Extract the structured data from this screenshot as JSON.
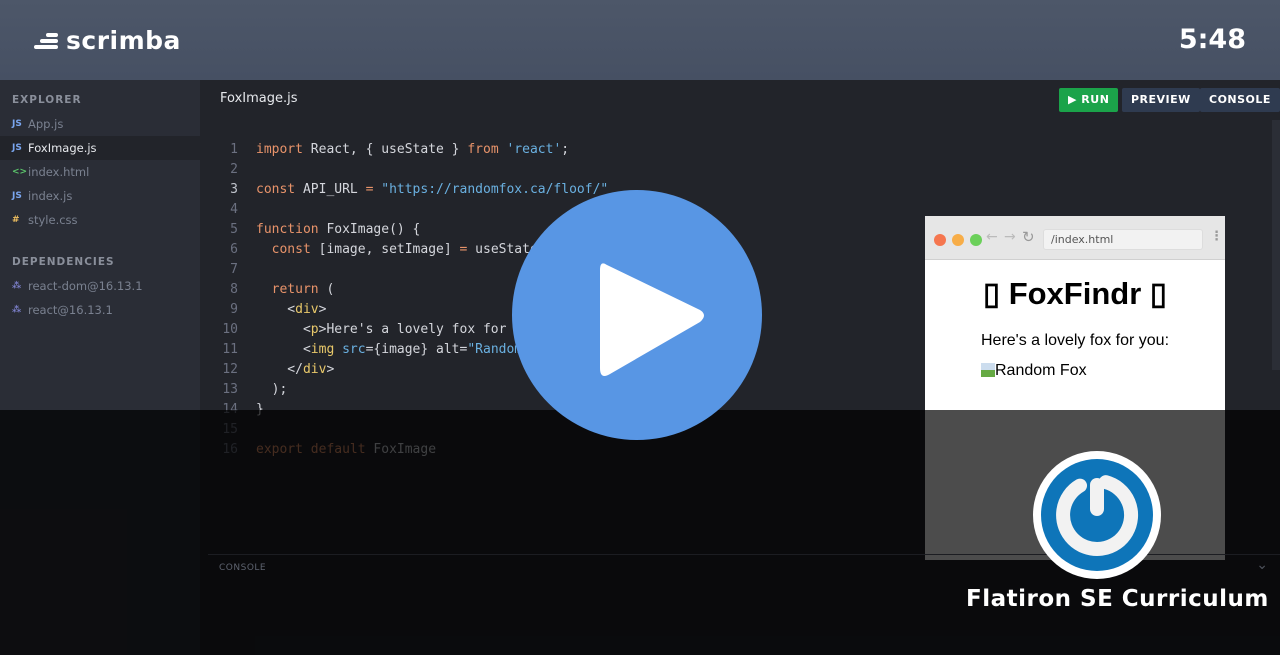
{
  "header": {
    "logo": "scrimba",
    "timer": "5:48"
  },
  "sidebar": {
    "explorer_label": "EXPLORER",
    "files": [
      {
        "name": "App.js",
        "icon": "JS",
        "type": "js",
        "active": false
      },
      {
        "name": "FoxImage.js",
        "icon": "JS",
        "type": "js",
        "active": true
      },
      {
        "name": "index.html",
        "icon": "<>",
        "type": "html",
        "active": false
      },
      {
        "name": "index.js",
        "icon": "JS",
        "type": "js",
        "active": false
      },
      {
        "name": "style.css",
        "icon": "#",
        "type": "css",
        "active": false
      }
    ],
    "dependencies_label": "DEPENDENCIES",
    "dependencies": [
      "react-dom@16.13.1",
      "react@16.13.1"
    ]
  },
  "editor": {
    "filename": "FoxImage.js",
    "run": "RUN",
    "preview": "PREVIEW",
    "console": "CONSOLE",
    "lines": [
      [
        [
          "import",
          "k"
        ],
        [
          " React, { useState } ",
          "p"
        ],
        [
          "from",
          "k"
        ],
        [
          " ",
          "p"
        ],
        [
          "'react'",
          "s"
        ],
        [
          ";",
          "p"
        ]
      ],
      [],
      [
        [
          "const",
          "k"
        ],
        [
          " API_URL ",
          "p"
        ],
        [
          "=",
          "k"
        ],
        [
          " ",
          "p"
        ],
        [
          "\"https://randomfox.ca/floof/\"",
          "s"
        ]
      ],
      [],
      [
        [
          "function",
          "k"
        ],
        [
          " FoxImage() {",
          "p"
        ]
      ],
      [
        [
          "  ",
          "p"
        ],
        [
          "const",
          "k"
        ],
        [
          " [image, setImage] ",
          "p"
        ],
        [
          "=",
          "k"
        ],
        [
          " useState(null)",
          "p"
        ]
      ],
      [],
      [
        [
          "  ",
          "p"
        ],
        [
          "return",
          "k"
        ],
        [
          " (",
          "p"
        ]
      ],
      [
        [
          "    <",
          "p"
        ],
        [
          "div",
          "t"
        ],
        [
          ">",
          "p"
        ]
      ],
      [
        [
          "      <",
          "p"
        ],
        [
          "p",
          "t"
        ],
        [
          ">Here's a lovely fox for you:</",
          "p"
        ],
        [
          "p",
          "t"
        ],
        [
          ">",
          "p"
        ]
      ],
      [
        [
          "      <",
          "p"
        ],
        [
          "img",
          "t"
        ],
        [
          " src",
          "s"
        ],
        [
          "={image} alt=",
          "p"
        ],
        [
          "\"Random Fox\"",
          "s"
        ],
        [
          " />",
          "p"
        ]
      ],
      [
        [
          "    </",
          "p"
        ],
        [
          "div",
          "t"
        ],
        [
          ">",
          "p"
        ]
      ],
      [
        [
          "  );",
          "p"
        ]
      ],
      [
        [
          "}",
          "p"
        ]
      ],
      [],
      [
        [
          "export",
          "k"
        ],
        [
          " ",
          "p"
        ],
        [
          "default",
          "k"
        ],
        [
          " FoxImage",
          "p"
        ]
      ]
    ]
  },
  "preview": {
    "url": "/index.html",
    "title": "▯ FoxFindr ▯",
    "text": "Here's a lovely fox for you:",
    "img_alt": "Random Fox"
  },
  "console_label": "CONSOLE",
  "brand": "Flatiron SE Curriculum",
  "colors": {
    "run": "#1ba34a",
    "button": "#2f3b50",
    "play": "#5896e4",
    "brand_logo": "#0e75b9"
  }
}
